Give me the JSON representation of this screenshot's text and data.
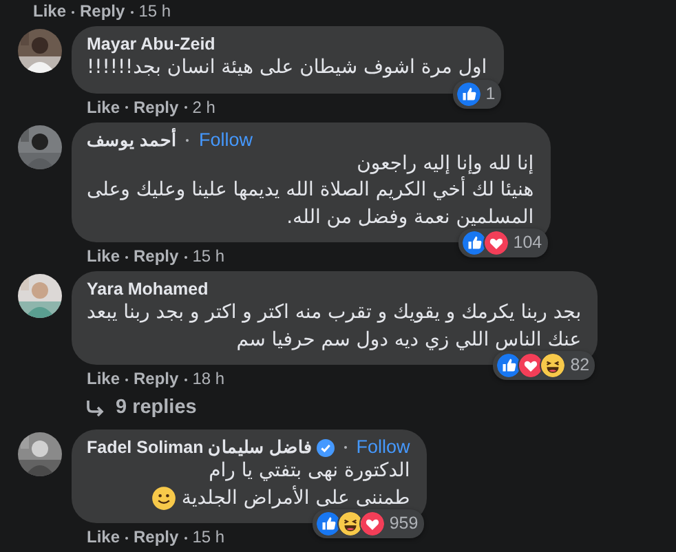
{
  "top_actions": {
    "like": "Like",
    "reply": "Reply",
    "time": "15 h"
  },
  "comments": [
    {
      "author": "Mayar Abu-Zeid",
      "verified": false,
      "body": [
        "اول مرة اشوف شيطان على هيئة انسان بجد!!!!!!"
      ],
      "smiley": false,
      "reactions": [
        {
          "kind": "like"
        }
      ],
      "reaction_count": "1",
      "actions": {
        "like": "Like",
        "reply": "Reply",
        "time": "2 h"
      }
    },
    {
      "author": "أحمد يوسف",
      "verified": false,
      "follow": "Follow",
      "body": [
        "إنا لله وإنا إليه راجعون",
        "هنيئا لك أخي الكريم الصلاة الله يديمها علينا وعليك وعلى",
        "المسلمين نعمة وفضل من الله."
      ],
      "smiley": false,
      "reactions": [
        {
          "kind": "like"
        },
        {
          "kind": "love"
        }
      ],
      "reaction_count": "104",
      "actions": {
        "like": "Like",
        "reply": "Reply",
        "time": "15 h"
      }
    },
    {
      "author": "Yara Mohamed",
      "verified": false,
      "body": [
        "بجد ربنا يكرمك و يقويك و تقرب منه اكتر و اكتر و بجد ربنا يبعد",
        "عنك الناس اللي زي ديه دول سم حرفيا سم"
      ],
      "smiley": false,
      "reactions": [
        {
          "kind": "like"
        },
        {
          "kind": "love"
        },
        {
          "kind": "haha"
        }
      ],
      "reaction_count": "82",
      "actions": {
        "like": "Like",
        "reply": "Reply",
        "time": "18 h"
      },
      "replies": "9 replies"
    },
    {
      "author": "Fadel Soliman فاضل سليمان",
      "verified": true,
      "follow": "Follow",
      "body": [
        "الدكتورة نهى بتفتي يا رام",
        "طمننى على الأمراض الجلدية"
      ],
      "smiley": true,
      "reactions": [
        {
          "kind": "like"
        },
        {
          "kind": "haha"
        },
        {
          "kind": "love"
        }
      ],
      "reaction_count": "959",
      "actions": {
        "like": "Like",
        "reply": "Reply",
        "time": "15 h"
      }
    }
  ]
}
